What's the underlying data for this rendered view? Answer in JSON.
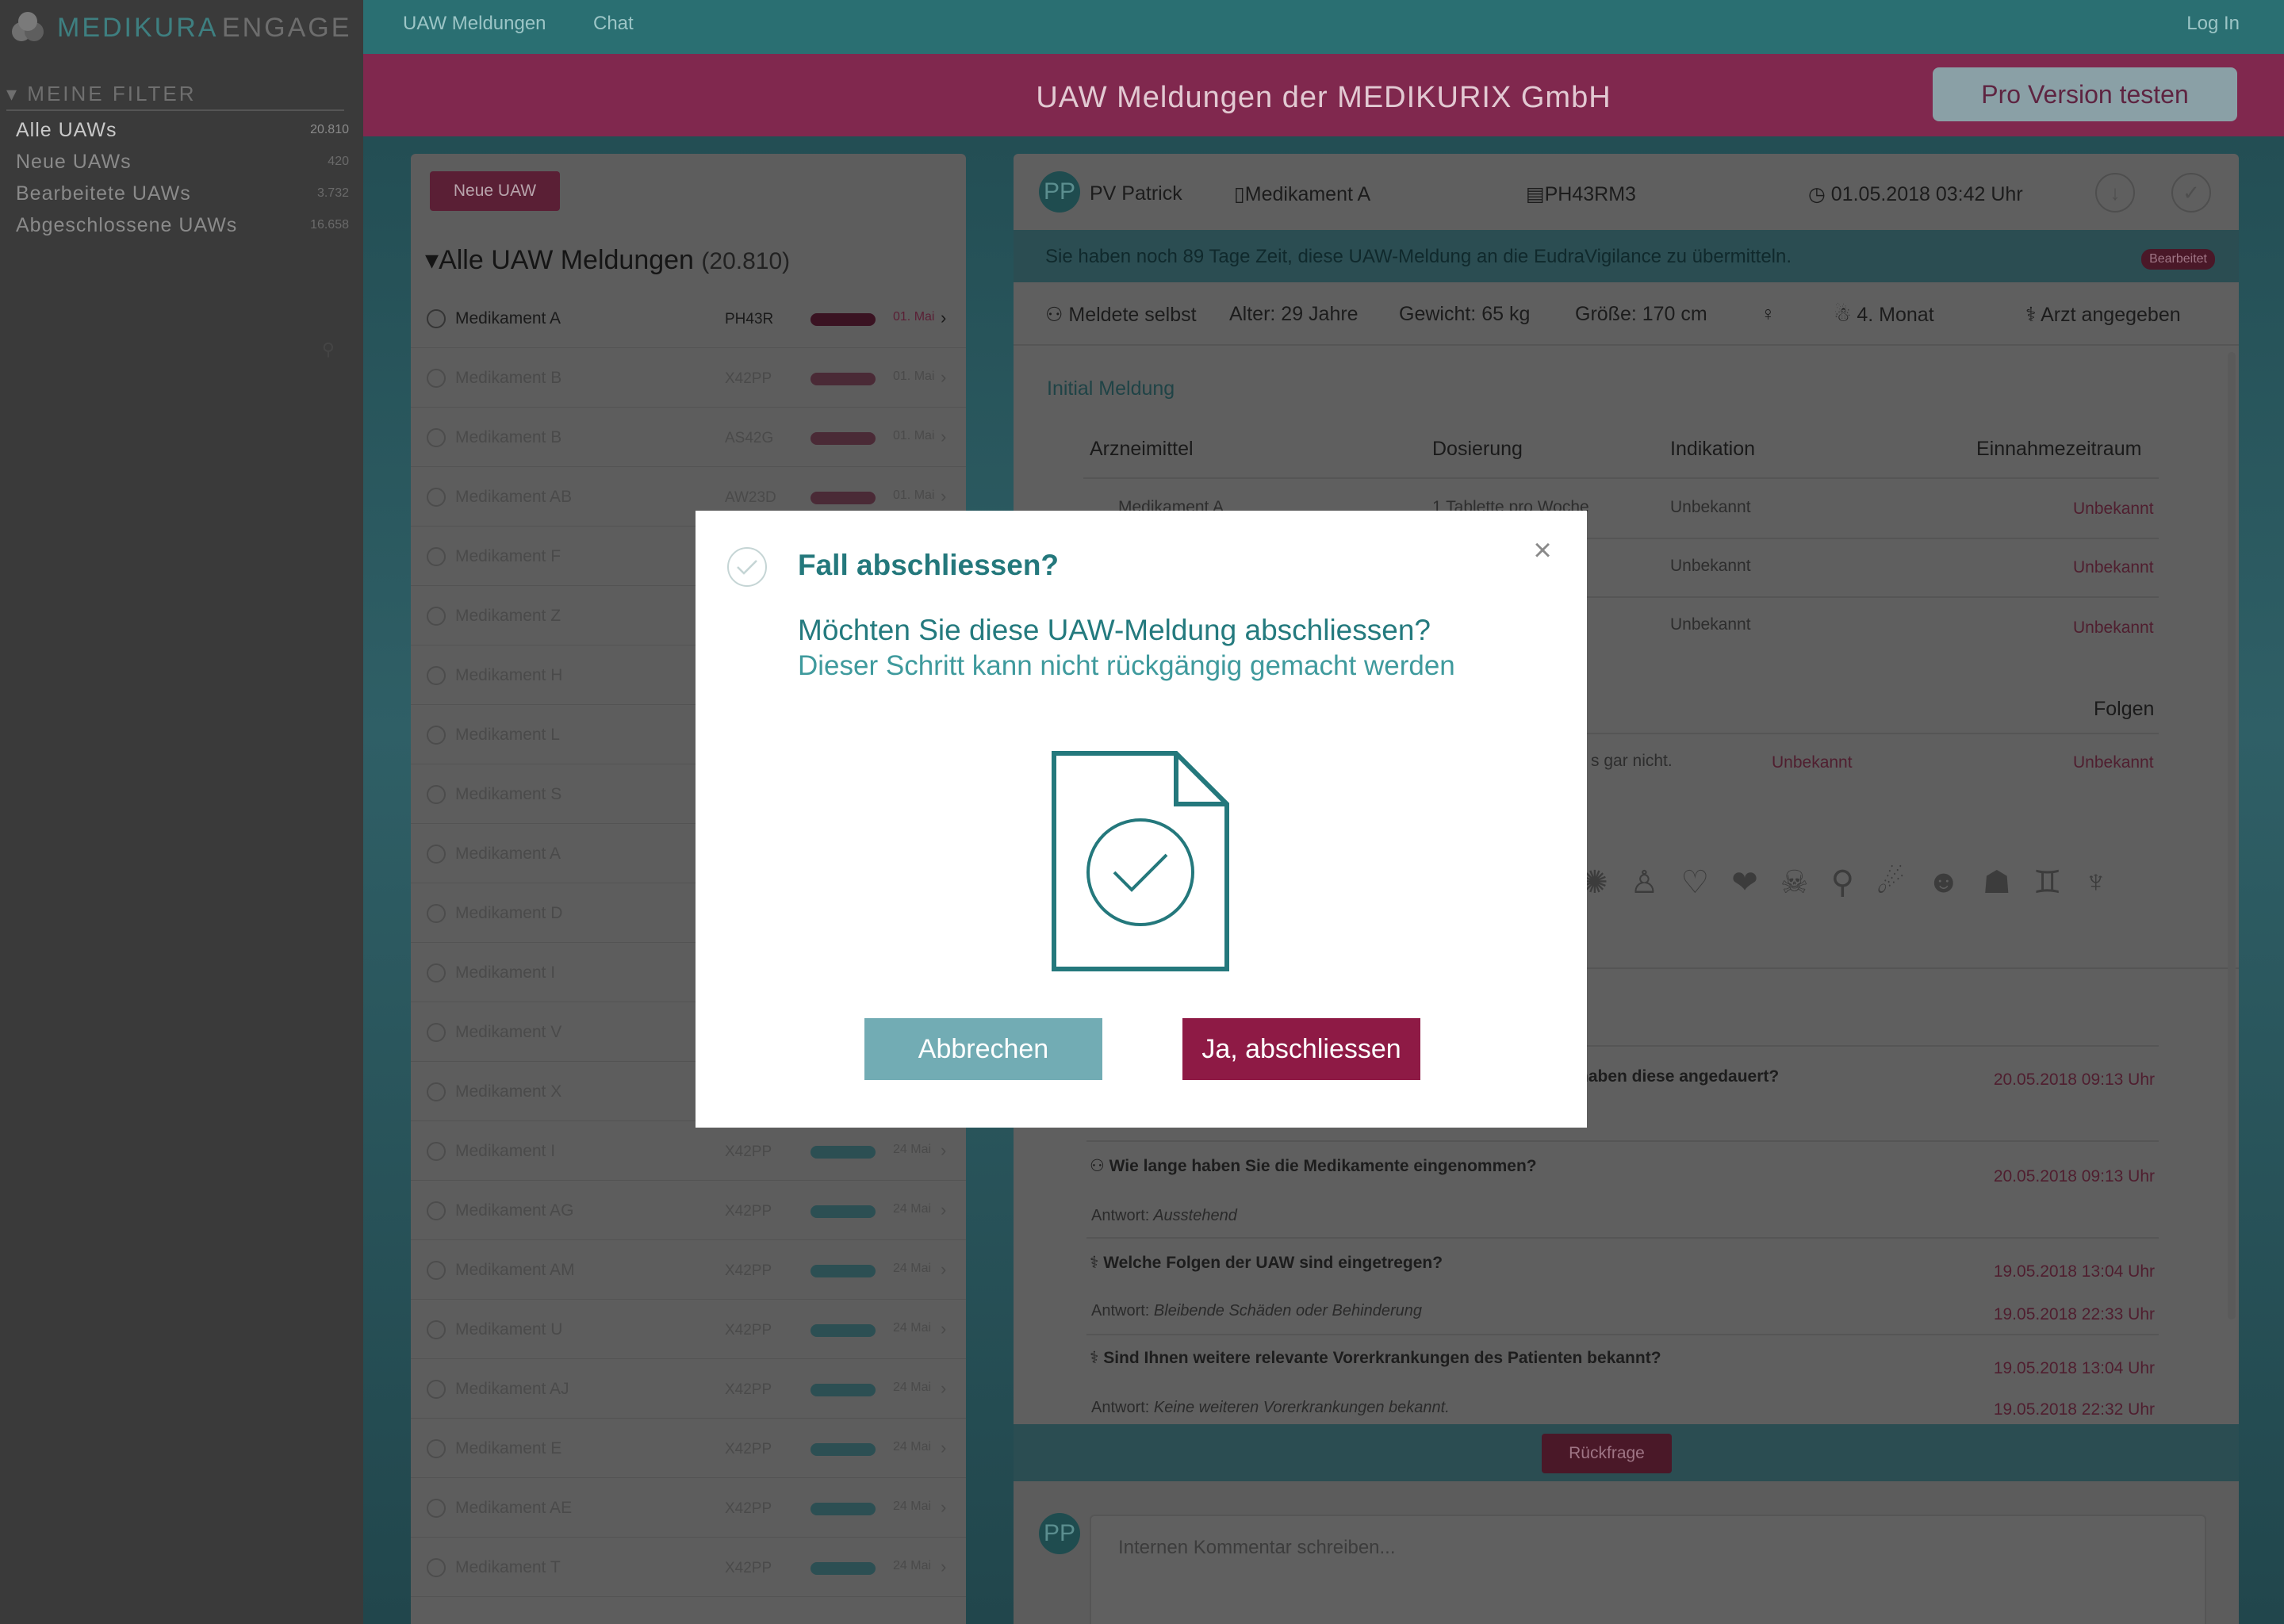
{
  "app": {
    "logo_part1": "MEDIKURA",
    "logo_part2": "ENGAGE"
  },
  "topnav": {
    "items": [
      "UAW Meldungen",
      "Chat"
    ],
    "login": "Log In"
  },
  "banner": {
    "title": "UAW Meldungen der MEDIKURIX GmbH",
    "pro_button": "Pro Version testen"
  },
  "sidebar": {
    "filter_header": "MEINE FILTER",
    "filters": [
      {
        "label": "Alle UAWs",
        "count": "20.810"
      },
      {
        "label": "Neue UAWs",
        "count": "420"
      },
      {
        "label": "Bearbeitete UAWs",
        "count": "3.732"
      },
      {
        "label": "Abgeschlossene UAWs",
        "count": "16.658"
      }
    ]
  },
  "list": {
    "new_button": "Neue UAW",
    "title": "Alle UAW Meldungen",
    "count": "(20.810)",
    "rows": [
      {
        "name": "Medikament A",
        "code": "PH43R",
        "date": "01. Mai",
        "status": "Neu"
      },
      {
        "name": "Medikament B",
        "code": "X42PP",
        "date": "01. Mai",
        "status": ""
      },
      {
        "name": "Medikament B",
        "code": "AS42G",
        "date": "01. Mai",
        "status": ""
      },
      {
        "name": "Medikament AB",
        "code": "AW23D",
        "date": "01. Mai",
        "status": ""
      },
      {
        "name": "Medikament F",
        "code": "",
        "date": "",
        "status": ""
      },
      {
        "name": "Medikament Z",
        "code": "",
        "date": "",
        "status": ""
      },
      {
        "name": "Medikament H",
        "code": "",
        "date": "",
        "status": ""
      },
      {
        "name": "Medikament L",
        "code": "",
        "date": "",
        "status": ""
      },
      {
        "name": "Medikament S",
        "code": "",
        "date": "",
        "status": ""
      },
      {
        "name": "Medikament A",
        "code": "",
        "date": "",
        "status": ""
      },
      {
        "name": "Medikament D",
        "code": "",
        "date": "",
        "status": ""
      },
      {
        "name": "Medikament I",
        "code": "",
        "date": "",
        "status": ""
      },
      {
        "name": "Medikament V",
        "code": "",
        "date": "",
        "status": ""
      },
      {
        "name": "Medikament X",
        "code": "",
        "date": "",
        "status": ""
      },
      {
        "name": "Medikament I",
        "code": "X42PP",
        "date": "24 Mai",
        "status": ""
      },
      {
        "name": "Medikament AG",
        "code": "X42PP",
        "date": "24 Mai",
        "status": ""
      },
      {
        "name": "Medikament AM",
        "code": "X42PP",
        "date": "24 Mai",
        "status": ""
      },
      {
        "name": "Medikament U",
        "code": "X42PP",
        "date": "24 Mai",
        "status": ""
      },
      {
        "name": "Medikament AJ",
        "code": "X42PP",
        "date": "24 Mai",
        "status": ""
      },
      {
        "name": "Medikament E",
        "code": "X42PP",
        "date": "24 Mai",
        "status": ""
      },
      {
        "name": "Medikament AE",
        "code": "X42PP",
        "date": "24 Mai",
        "status": ""
      },
      {
        "name": "Medikament T",
        "code": "X42PP",
        "date": "24 Mai",
        "status": ""
      }
    ]
  },
  "detail": {
    "avatar": "PP",
    "reporter": "PV Patrick",
    "drug": "Medikament A",
    "case_id": "PH43RM3",
    "datetime": "01.05.2018 03:42 Uhr",
    "info_text": "Sie haben noch 89 Tage Zeit, diese UAW-Meldung an die EudraVigilance zu übermitteln.",
    "badge": "Bearbeitet",
    "patient": {
      "reporter": "Meldete selbst",
      "age": "Alter: 29 Jahre",
      "weight": "Gewicht: 65 kg",
      "height": "Größe:  170 cm",
      "pregnancy": "4. Monat",
      "doctor": "Arzt angegeben"
    },
    "section_title": "Initial Meldung",
    "table_headers": [
      "Arzneimittel",
      "Dosierung",
      "Indikation",
      "Einnahmezeitraum"
    ],
    "table_rows": [
      {
        "drug": "Medikament A",
        "dose": "1 Tablette pro Woche",
        "indication": "Unbekannt",
        "period": "Unbekannt"
      },
      {
        "drug": "",
        "dose": "",
        "indication": "Unbekannt",
        "period": "Unbekannt"
      },
      {
        "drug": "",
        "dose": "",
        "indication": "Unbekannt",
        "period": "Unbekannt"
      }
    ],
    "effects_header": "Folgen",
    "effects_row": {
      "text": "s gar nicht.",
      "c1": "Unbekannt",
      "c2": "Unbekannt"
    },
    "questions": [
      {
        "q": "haben diese angedauert?",
        "date": "20.05.2018 09:13 Uhr",
        "answer_label": "",
        "answer": "",
        "answer_date": ""
      },
      {
        "q": "Wie lange haben Sie die Medikamente eingenommen?",
        "date": "20.05.2018 09:13 Uhr",
        "answer_label": "Antwort:",
        "answer": "Ausstehend",
        "answer_date": ""
      },
      {
        "q": "Welche Folgen der UAW sind eingetregen?",
        "date": "19.05.2018 13:04 Uhr",
        "answer_label": "Antwort:",
        "answer": "Bleibende Schäden oder Behinderung",
        "answer_date": "19.05.2018 22:33 Uhr"
      },
      {
        "q": "Sind Ihnen weitere relevante Vorerkrankungen des Patienten bekannt?",
        "date": "19.05.2018 13:04 Uhr",
        "answer_label": "Antwort:",
        "answer": "Keine weiteren Vorerkrankungen bekannt.",
        "answer_date": "19.05.2018 22:32 Uhr"
      }
    ],
    "rueckfrage_button": "Rückfrage",
    "comment_placeholder": "Internen Kommentar schreiben..."
  },
  "modal": {
    "title": "Fall abschliessen?",
    "question": "Möchten Sie diese UAW-Meldung abschliessen?",
    "subtitle": "Dieser Schritt kann nicht rückgängig gemacht werden",
    "cancel": "Abbrechen",
    "confirm": "Ja, abschliessen"
  },
  "colors": {
    "teal": "#24787c",
    "burgundy": "#8e1a45",
    "cancel": "#72acb4"
  }
}
